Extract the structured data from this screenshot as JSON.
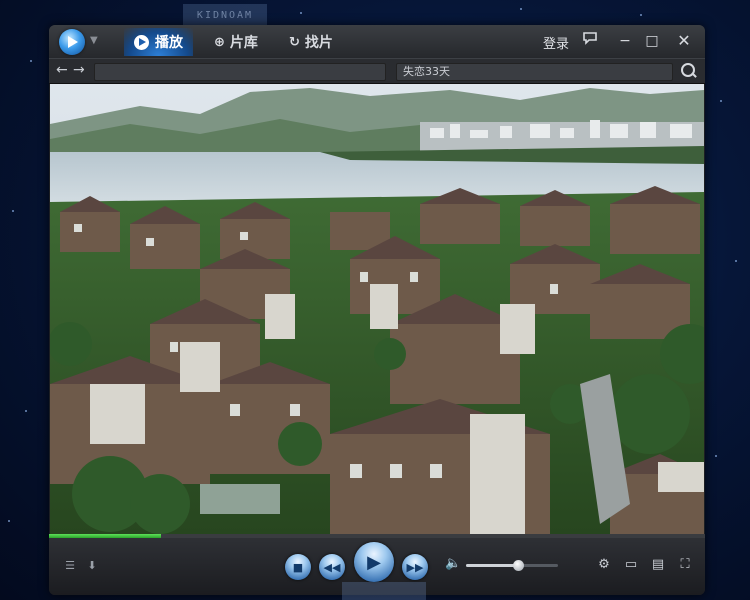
{
  "app": {
    "tabs": [
      {
        "label": "播放",
        "active": true
      },
      {
        "label": "片库",
        "active": false
      },
      {
        "label": "找片",
        "active": false
      }
    ],
    "login_label": "登录",
    "watermark_text": "KIDNOAM"
  },
  "navbar": {
    "address_value": "",
    "search_value": "失恋33天"
  },
  "playback": {
    "progress_fraction": 0.17,
    "volume_fraction": 0.57
  },
  "colors": {
    "accent_blue": "#2d7fd6",
    "progress_green": "#3fbf3a",
    "frame_bg": "#1d1f23"
  },
  "icons": {
    "play": "play-icon",
    "prev": "skip-back-icon",
    "next": "skip-forward-icon",
    "stop": "stop-icon",
    "volume": "speaker-icon",
    "settings": "gear-icon"
  }
}
